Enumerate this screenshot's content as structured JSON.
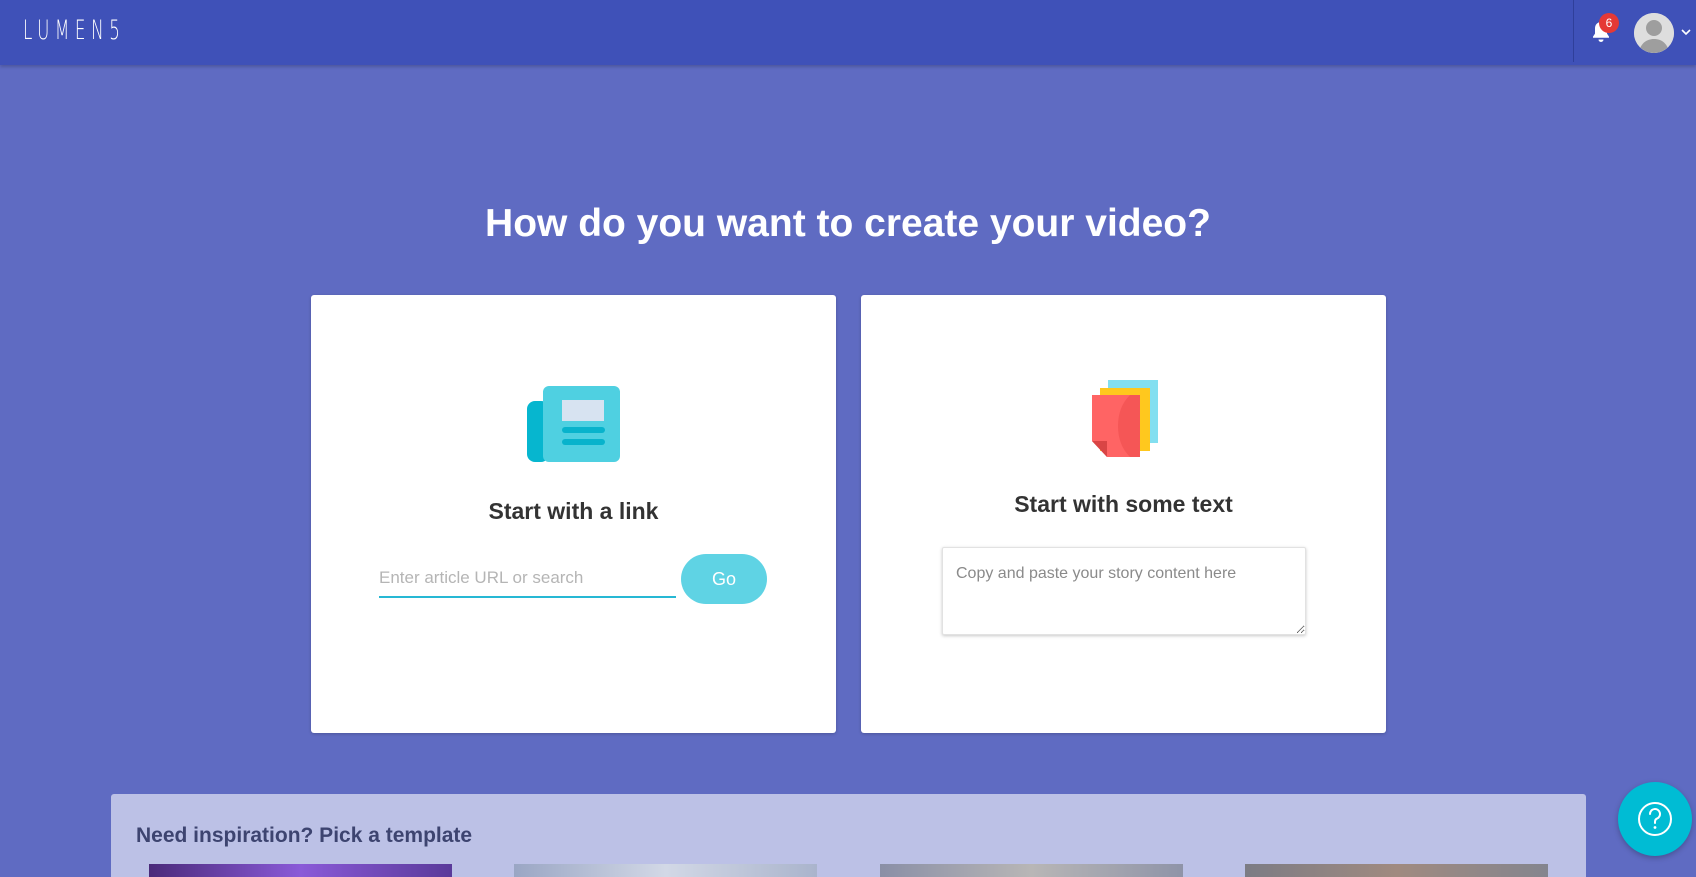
{
  "header": {
    "logo_text": "LUMEN5",
    "notification_count": "6",
    "bell_icon": "bell-icon",
    "avatar_icon": "user-avatar-icon",
    "caret_icon": "chevron-down-icon"
  },
  "main": {
    "title": "How do you want to create your video?",
    "link_card": {
      "icon": "newspaper-icon",
      "title": "Start with a link",
      "input_placeholder": "Enter article URL or search",
      "input_value": "",
      "button_label": "Go"
    },
    "text_card": {
      "icon": "stacked-pages-icon",
      "title": "Start with some text",
      "textarea_placeholder": "Copy and paste your story content here",
      "textarea_value": ""
    }
  },
  "inspiration": {
    "title": "Need inspiration? Pick a template",
    "templates": [
      {
        "name": "template-1"
      },
      {
        "name": "template-2"
      },
      {
        "name": "template-3"
      },
      {
        "name": "template-4"
      }
    ]
  },
  "help": {
    "icon": "help-question-icon"
  },
  "colors": {
    "background": "#5f6bc2",
    "topbar": "#3f51b8",
    "accent": "#26b8d4",
    "go_button": "#5fd3e4",
    "badge": "#e53935",
    "help_button": "#00bcd4",
    "inspiration_panel": "#bcc1e6"
  }
}
